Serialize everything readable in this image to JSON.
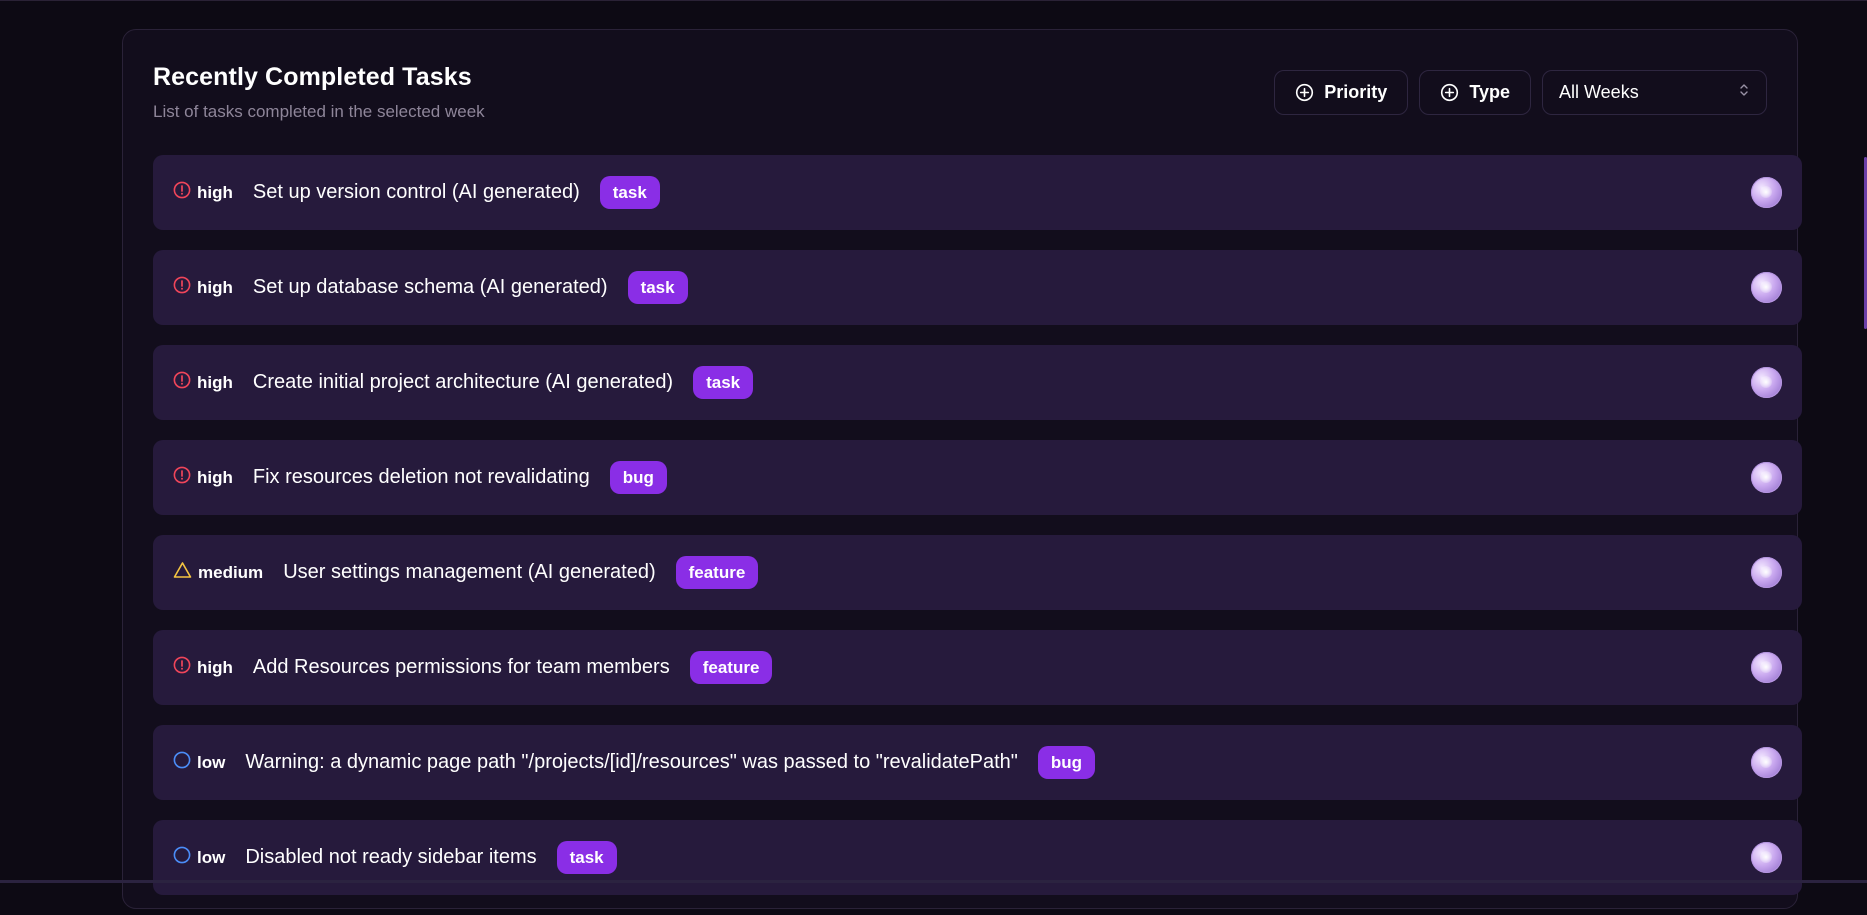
{
  "header": {
    "title": "Recently Completed Tasks",
    "subtitle": "List of tasks completed in the selected week"
  },
  "controls": {
    "priority_label": "Priority",
    "type_label": "Type",
    "week_select": "All Weeks"
  },
  "colors": {
    "high": "#f0455a",
    "medium": "#f5c542",
    "low": "#4b8df8",
    "badge": "#8a2ee6",
    "row_bg": "#261a3c"
  },
  "tasks": [
    {
      "priority": "high",
      "title": "Set up version control (AI generated)",
      "type": "task"
    },
    {
      "priority": "high",
      "title": "Set up database schema (AI generated)",
      "type": "task"
    },
    {
      "priority": "high",
      "title": "Create initial project architecture (AI generated)",
      "type": "task"
    },
    {
      "priority": "high",
      "title": "Fix resources deletion not revalidating",
      "type": "bug"
    },
    {
      "priority": "medium",
      "title": "User settings management (AI generated)",
      "type": "feature"
    },
    {
      "priority": "high",
      "title": "Add Resources permissions for team members",
      "type": "feature"
    },
    {
      "priority": "low",
      "title": "Warning: a dynamic page path \"/projects/[id]/resources\" was passed to \"revalidatePath\"",
      "type": "bug"
    },
    {
      "priority": "low",
      "title": "Disabled not ready sidebar items",
      "type": "task"
    }
  ]
}
